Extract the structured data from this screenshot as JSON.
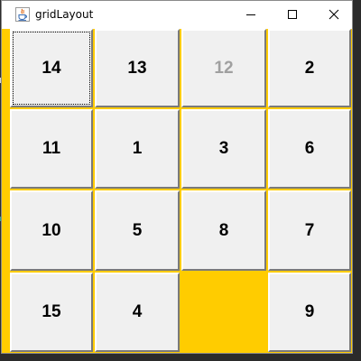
{
  "window": {
    "title": "gridLayout",
    "icon": "java-coffee-icon",
    "controls": {
      "minimize_icon": "minimize-icon",
      "maximize_icon": "maximize-icon",
      "close_icon": "close-icon"
    }
  },
  "grid": {
    "rows": 4,
    "columns": 4,
    "background_color": "#ffcc00",
    "tiles": [
      {
        "label": "14",
        "state": "focused"
      },
      {
        "label": "13",
        "state": "normal"
      },
      {
        "label": "12",
        "state": "disabled"
      },
      {
        "label": "2",
        "state": "normal"
      },
      {
        "label": "11",
        "state": "normal"
      },
      {
        "label": "1",
        "state": "normal"
      },
      {
        "label": "3",
        "state": "normal"
      },
      {
        "label": "6",
        "state": "normal"
      },
      {
        "label": "10",
        "state": "normal"
      },
      {
        "label": "5",
        "state": "normal"
      },
      {
        "label": "8",
        "state": "normal"
      },
      {
        "label": "7",
        "state": "normal"
      },
      {
        "label": "15",
        "state": "normal"
      },
      {
        "label": "4",
        "state": "normal"
      },
      {
        "label": "",
        "state": "empty"
      },
      {
        "label": "9",
        "state": "normal"
      }
    ]
  }
}
